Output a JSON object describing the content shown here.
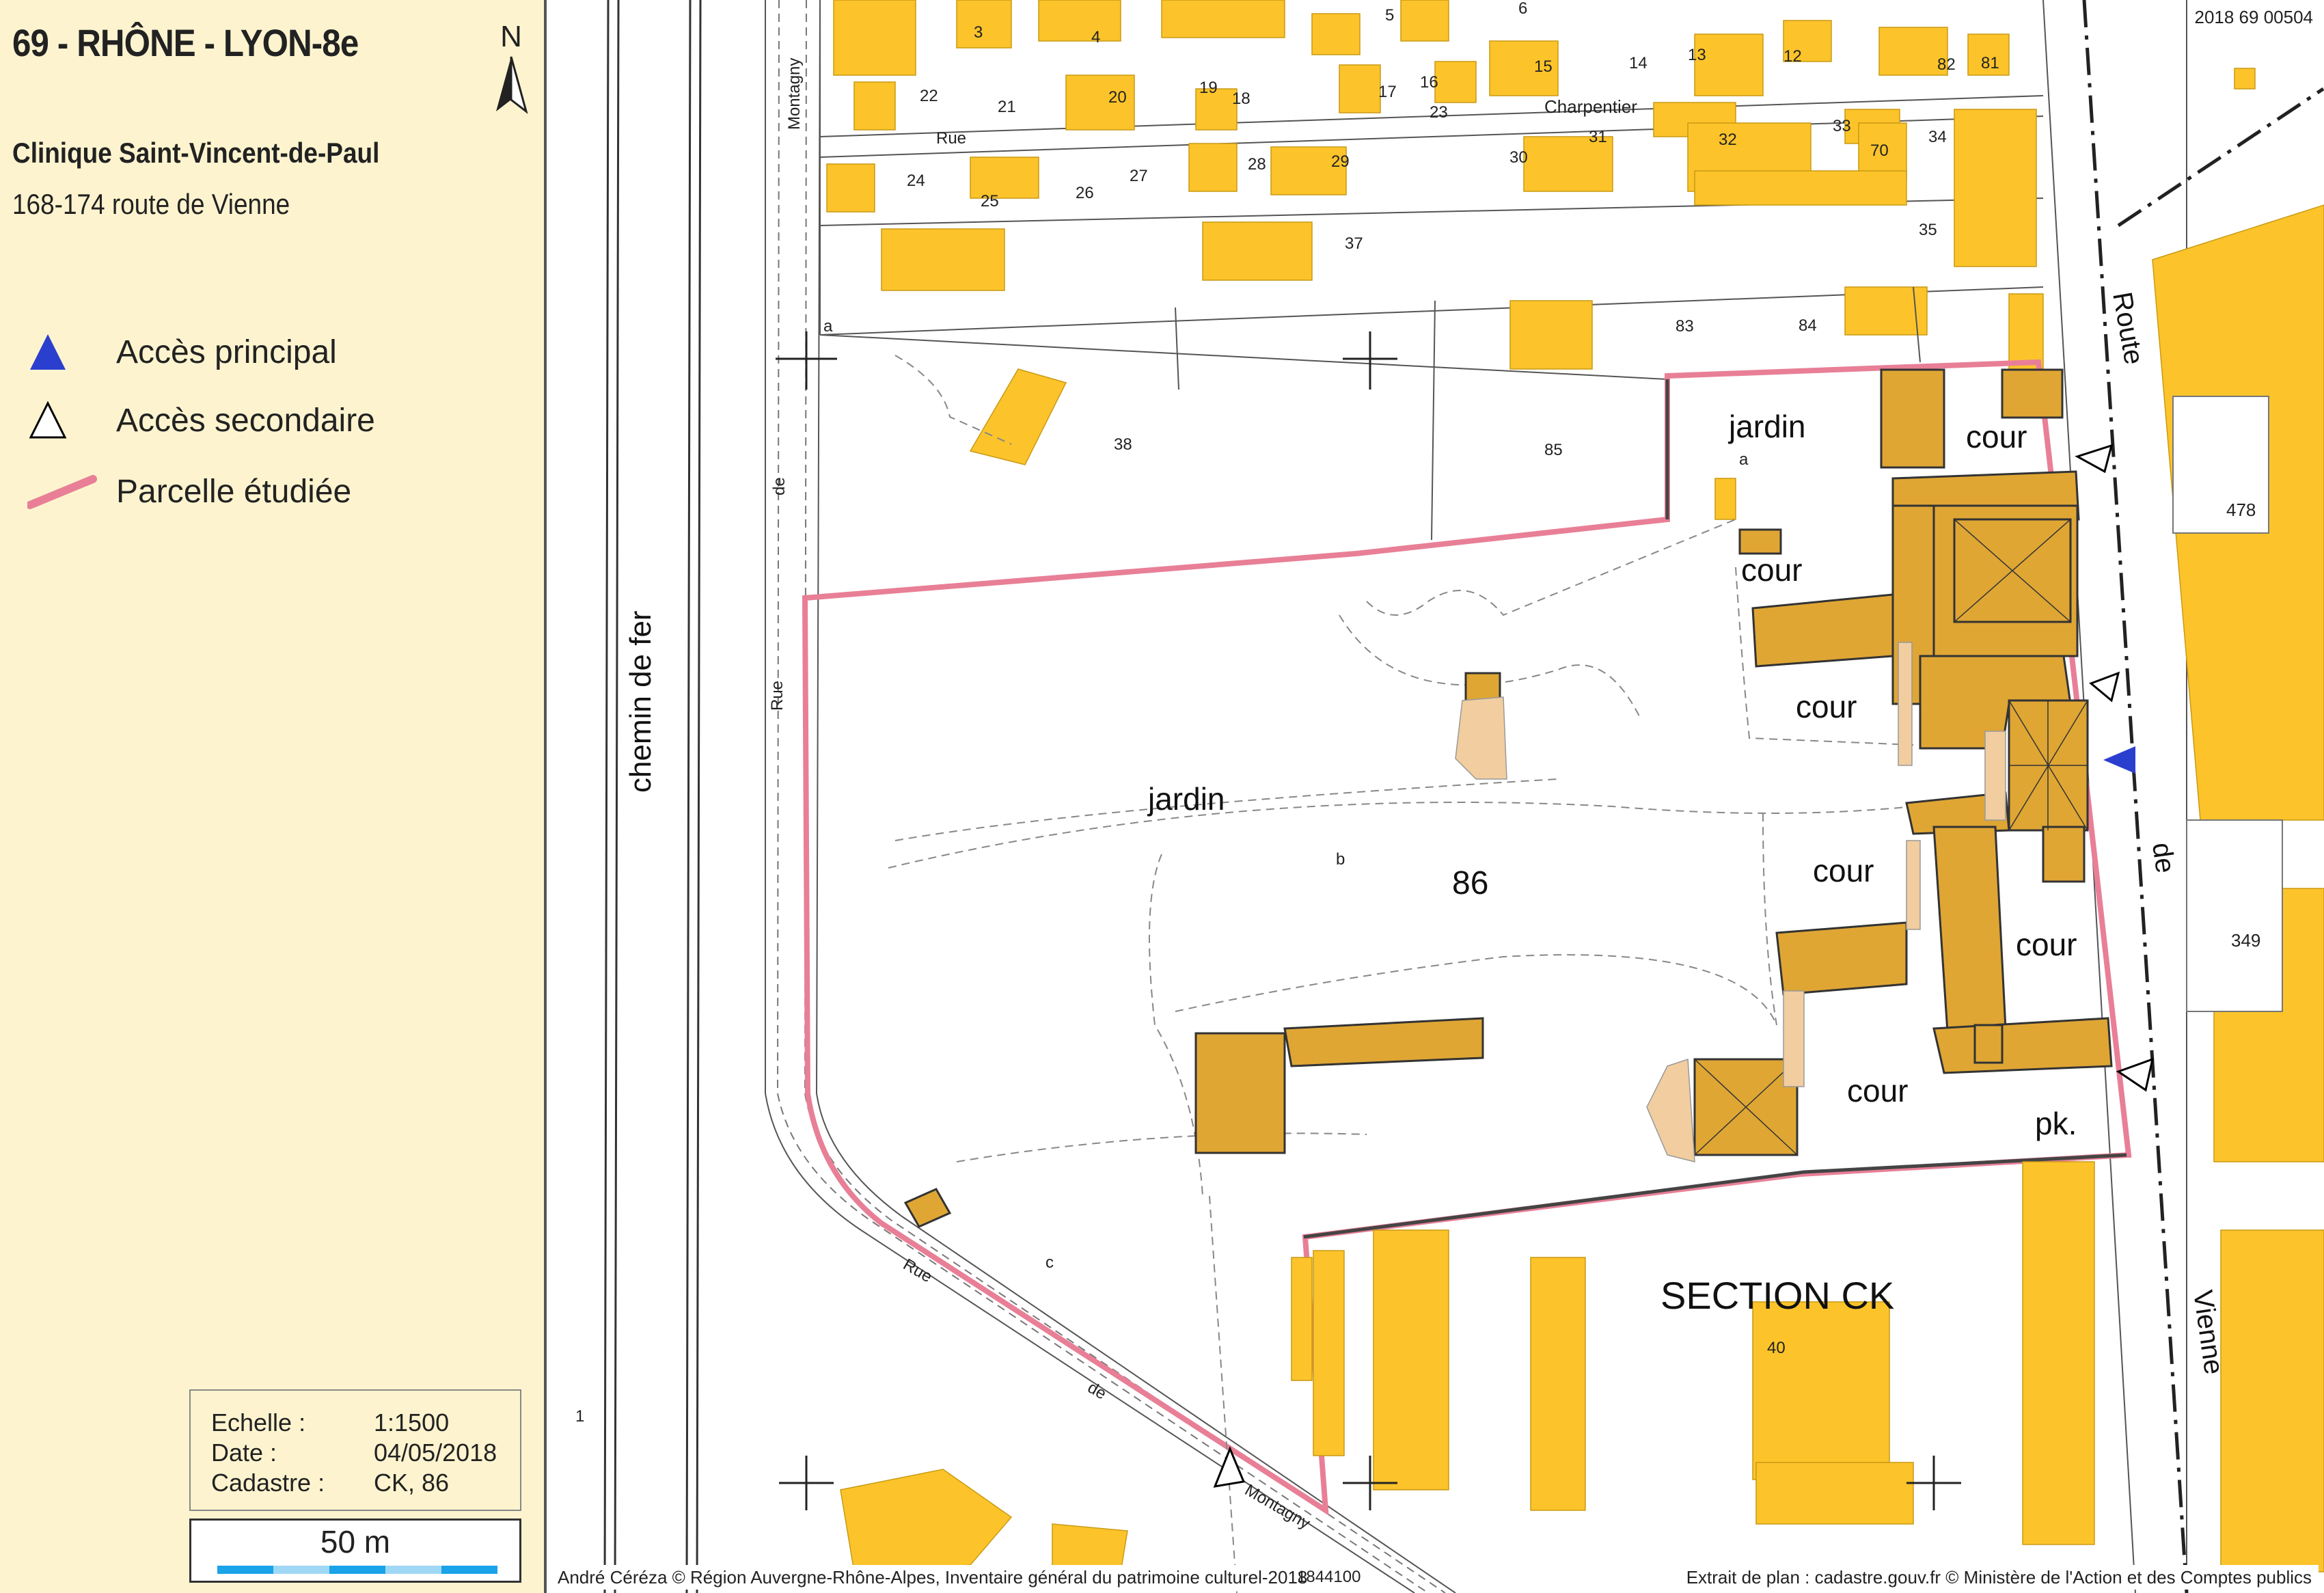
{
  "header": {
    "title": "69 - RHÔNE - LYON-8e",
    "subtitle": "Clinique Saint-Vincent-de-Paul",
    "address": "168-174 route de Vienne",
    "north_label": "N"
  },
  "legend": {
    "items": [
      {
        "label": "Accès principal",
        "symbol": "filled-triangle",
        "color": "#2b3fce"
      },
      {
        "label": "Accès secondaire",
        "symbol": "outline-triangle",
        "color": "#000000"
      },
      {
        "label": "Parcelle étudiée",
        "symbol": "pink-line",
        "color": "#e87f97"
      }
    ]
  },
  "info": {
    "scale_label": "Echelle :",
    "scale_value": "1:1500",
    "date_label": "Date    :",
    "date_value": "04/05/2018",
    "cadastre_label": "Cadastre :",
    "cadastre_value": "CK, 86"
  },
  "scalebar": {
    "label": "50 m",
    "colors": [
      "#1aa3e8",
      "#9fd8f5"
    ]
  },
  "map": {
    "reference": "2018 69 00504",
    "section_label": "SECTION CK",
    "coordinate": "1844100",
    "credit_left": "André Céréza © Région Auvergne-Rhône-Alpes, Inventaire général du patrimoine culturel-2018",
    "credit_right": "Extrait de plan : cadastre.gouv.fr © Ministère de l'Action et des Comptes publics",
    "building_color": "#fcc42a",
    "studied_building_color": "#dfa634",
    "light_building_color": "#f1cda0",
    "parcel_color": "#e87f97",
    "streets": {
      "railway": "chemin  de  fer",
      "rue_left": [
        "Rue",
        "de",
        "Montagny"
      ],
      "rue_bottom": [
        "Rue",
        "de",
        "Montagny"
      ],
      "route": [
        "Route",
        "de",
        "Vienne"
      ],
      "rue_top": [
        "Rue",
        "Charpentier"
      ]
    },
    "zones": {
      "jardin_main": "jardin",
      "jardin_top": "jardin",
      "cour_1": "cour",
      "cour_2": "cour",
      "cour_3": "cour",
      "cour_4": "cour",
      "cour_5": "cour",
      "cour_6": "cour",
      "parking": "pk."
    },
    "parcel_main": "86",
    "sub_letters": [
      "a",
      "b",
      "c",
      "a"
    ],
    "parcel_numbers": [
      "3",
      "4",
      "5",
      "6",
      "22",
      "21",
      "20",
      "19",
      "18",
      "17",
      "16",
      "23",
      "15",
      "14",
      "13",
      "12",
      "82",
      "81",
      "24",
      "25",
      "26",
      "27",
      "28",
      "29",
      "30",
      "31",
      "32",
      "70",
      "33",
      "34",
      "35",
      "37",
      "83",
      "84",
      "38",
      "85",
      "478",
      "349",
      "40",
      "1"
    ]
  }
}
